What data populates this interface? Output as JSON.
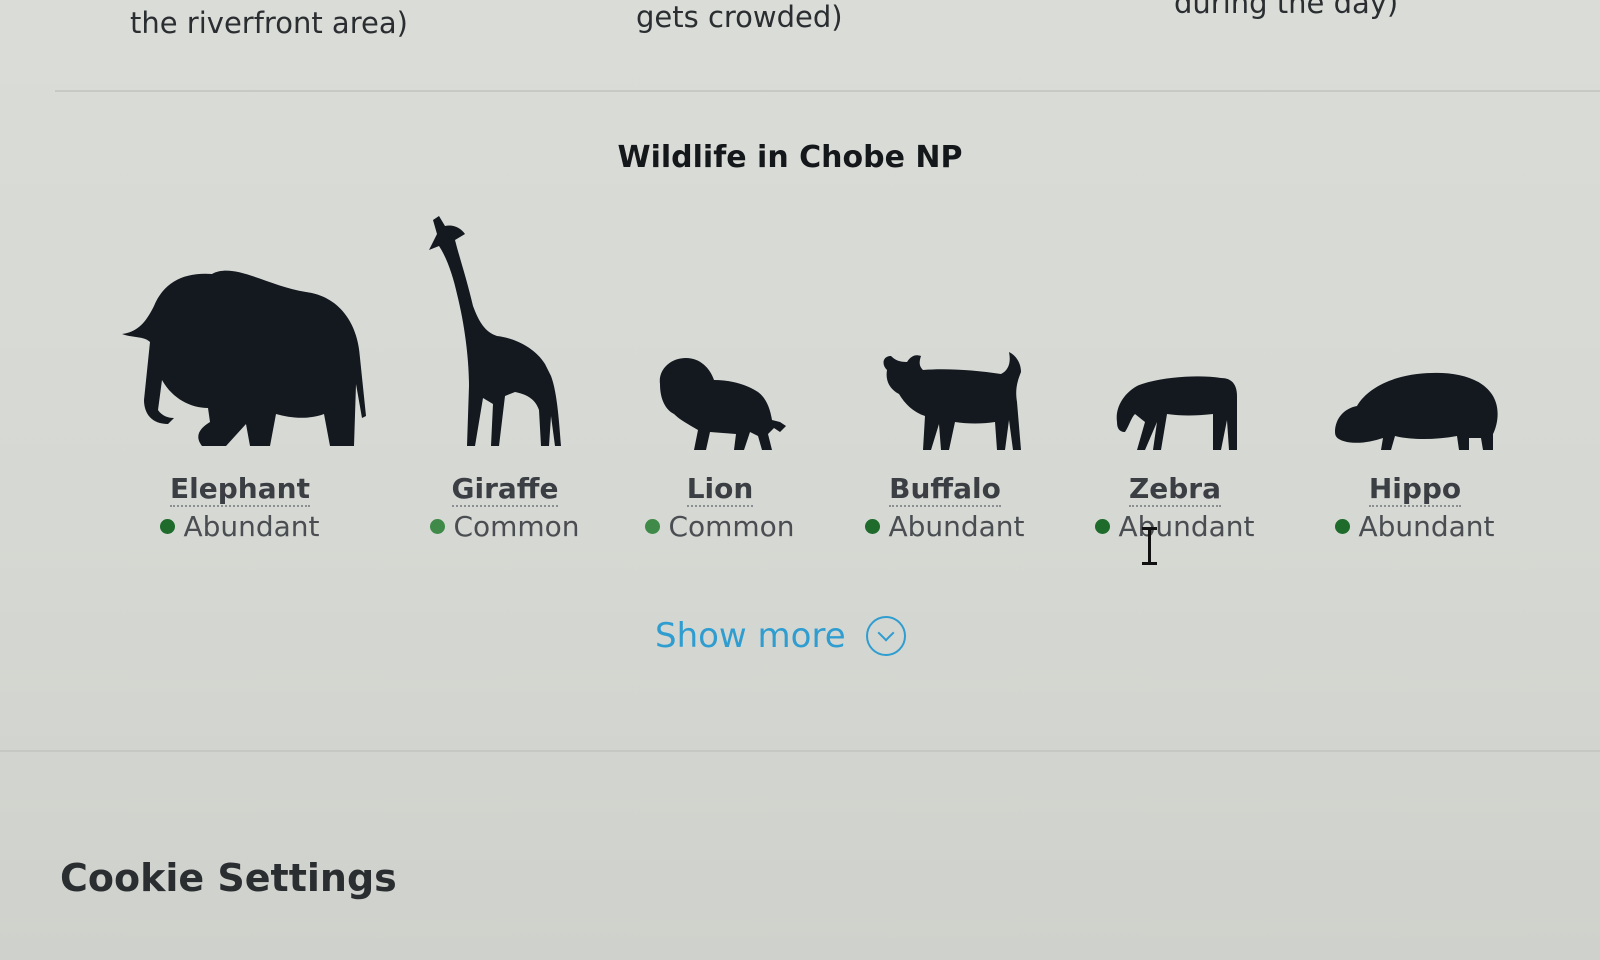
{
  "top_row": {
    "col1": "the riverfront area)",
    "col2": "gets crowded)",
    "col3": "during the day)"
  },
  "wildlife": {
    "title": "Wildlife in Chobe NP",
    "animals": [
      {
        "name": "Elephant",
        "status": "Abundant",
        "icon": "elephant-icon"
      },
      {
        "name": "Giraffe",
        "status": "Common",
        "icon": "giraffe-icon"
      },
      {
        "name": "Lion",
        "status": "Common",
        "icon": "lion-icon"
      },
      {
        "name": "Buffalo",
        "status": "Abundant",
        "icon": "buffalo-icon"
      },
      {
        "name": "Zebra",
        "status": "Abundant",
        "icon": "zebra-icon"
      },
      {
        "name": "Hippo",
        "status": "Abundant",
        "icon": "hippo-icon"
      }
    ],
    "show_more_label": "Show more"
  },
  "cookie_settings": {
    "title": "Cookie Settings"
  },
  "colors": {
    "abundant": "#1f6b2c",
    "common": "#3f8a48",
    "link": "#2f9dd0"
  }
}
